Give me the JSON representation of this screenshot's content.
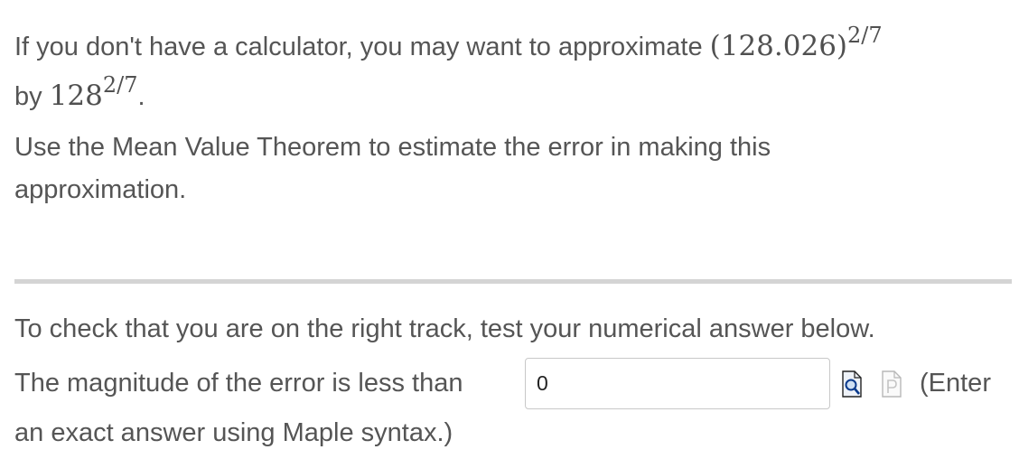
{
  "question": {
    "line1_text": "If you don't have a calculator, you may want to approximate",
    "line1_math_base": "(128.026)",
    "line1_math_exp": "2/7",
    "line2_text": "by",
    "line2_math_base": "128",
    "line2_math_exp": "2/7",
    "line2_period": ".",
    "line3_text": "Use the Mean Value Theorem to estimate the error in making this",
    "line4_text": "approximation."
  },
  "check": {
    "intro_text": "To check that you are on the right track, test your numerical answer below.",
    "prompt_text": "The magnitude of the error is less than",
    "answer_value": "0",
    "enter_text": "(Enter",
    "syntax_text": "an exact answer using Maple syntax.)"
  },
  "icons": {
    "preview": "magnifier-document-icon",
    "paste": "document-p-icon"
  }
}
